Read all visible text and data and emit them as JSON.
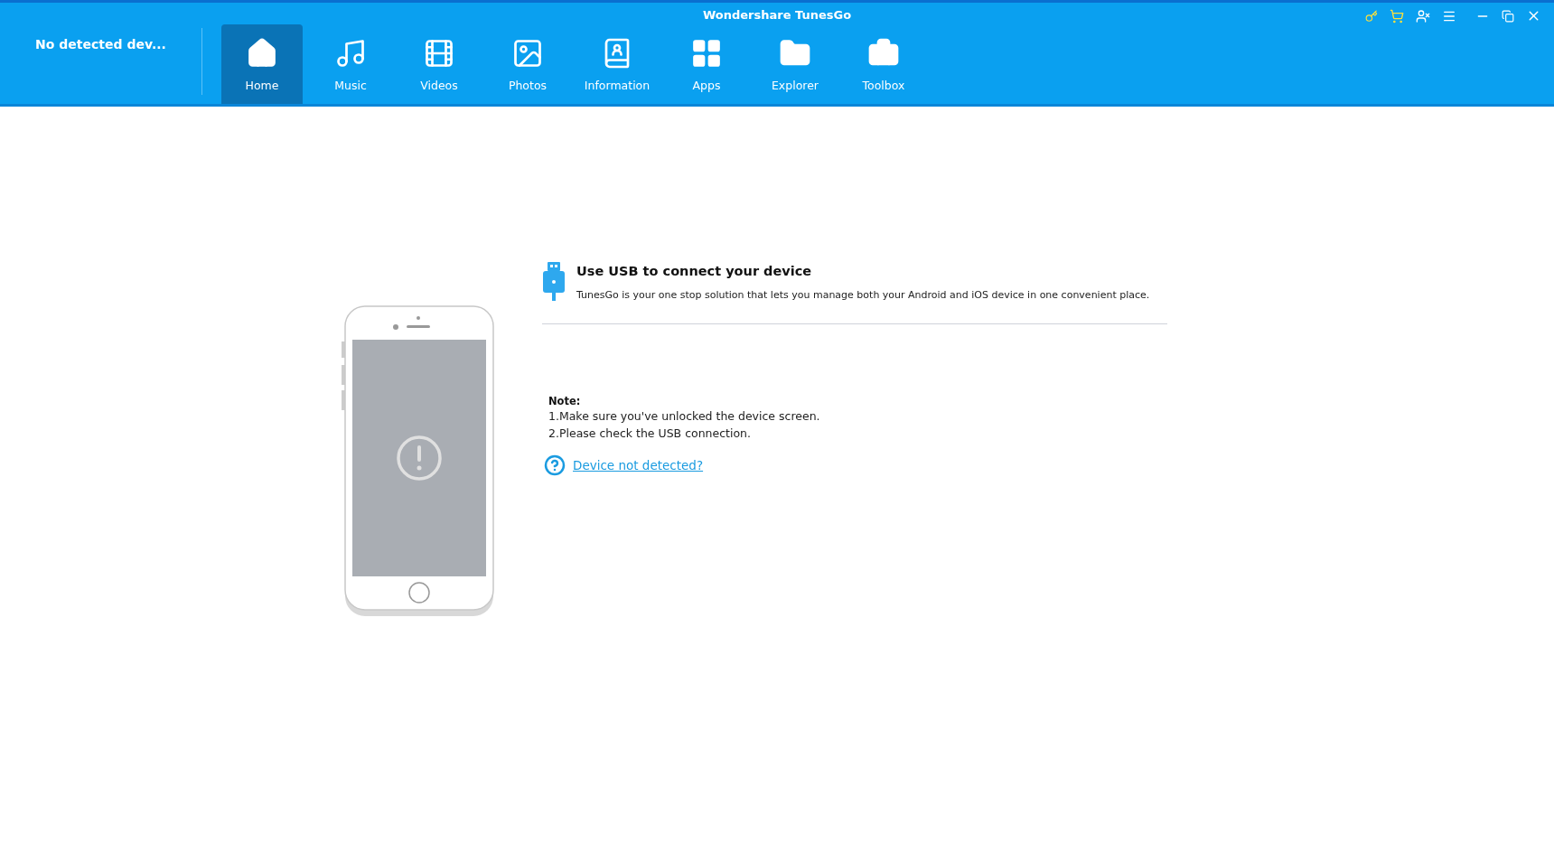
{
  "window": {
    "title": "Wondershare TunesGo"
  },
  "device": {
    "label": "No detected dev..."
  },
  "tabs": [
    {
      "label": "Home",
      "selected": true
    },
    {
      "label": "Music",
      "selected": false
    },
    {
      "label": "Videos",
      "selected": false
    },
    {
      "label": "Photos",
      "selected": false
    },
    {
      "label": "Information",
      "selected": false
    },
    {
      "label": "Apps",
      "selected": false
    },
    {
      "label": "Explorer",
      "selected": false
    },
    {
      "label": "Toolbox",
      "selected": false
    }
  ],
  "connect": {
    "title": "Use USB to connect your device",
    "description": "TunesGo is your one stop solution that lets you manage both your Android and iOS device in one convenient place."
  },
  "note": {
    "heading": "Note:",
    "items": [
      "1.Make sure you've unlocked the device screen.",
      "2.Please check the USB connection."
    ]
  },
  "help_link": "Device not detected?"
}
